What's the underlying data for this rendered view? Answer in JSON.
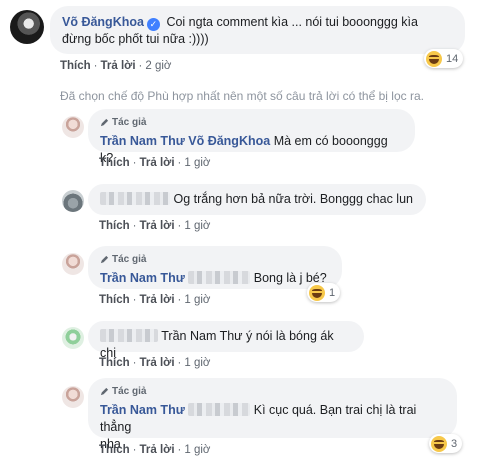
{
  "comments": [
    {
      "author": "Võ ĐăngKhoa",
      "verified": true,
      "text_line1": "Coi ngta comment kìa ... nói tui booonggg kìa",
      "text_line2": "đừng bốc phốt tui nữa :))))",
      "actions": [
        "Thích",
        "Trả lời",
        "2 giờ"
      ],
      "reaction_icon": "haha-emoji-icon",
      "reaction_count": "14"
    }
  ],
  "filter_note": "Đã chọn chế độ Phù hợp nhất nên một số câu trả lời có thể bị lọc ra.",
  "replies": [
    {
      "author_badge": "Tác giả",
      "author": "Trần Nam Thư",
      "mention": "Võ ĐăngKhoa",
      "text": "Mà em có booonggg k?",
      "actions": [
        "Thích",
        "Trả lời",
        "1 giờ"
      ]
    },
    {
      "author": "",
      "text": "Og trắng hơn bả nữa trời. Bonggg chac lun",
      "actions": [
        "Thích",
        "Trả lời",
        "1 giờ"
      ]
    },
    {
      "author_badge": "Tác giả",
      "author": "Trần Nam Thư",
      "text": "Bong là j bé?",
      "actions": [
        "Thích",
        "Trả lời",
        "1 giờ"
      ],
      "reaction_icon": "haha-emoji-icon",
      "reaction_count": "1"
    },
    {
      "author": "",
      "text": "Trần Nam Thư ý nói là bóng ák chị",
      "actions": [
        "Thích",
        "Trả lời",
        "1 giờ"
      ]
    },
    {
      "author_badge": "Tác giả",
      "author": "Trần Nam Thư",
      "text_line1": "Kì cục quá. Bạn trai chị là trai thẳng",
      "text_line2": "nha",
      "actions": [
        "Thích",
        "Trả lời",
        "1 giờ"
      ],
      "reaction_icon": "haha-emoji-icon",
      "reaction_count": "3"
    }
  ],
  "separator": "·"
}
